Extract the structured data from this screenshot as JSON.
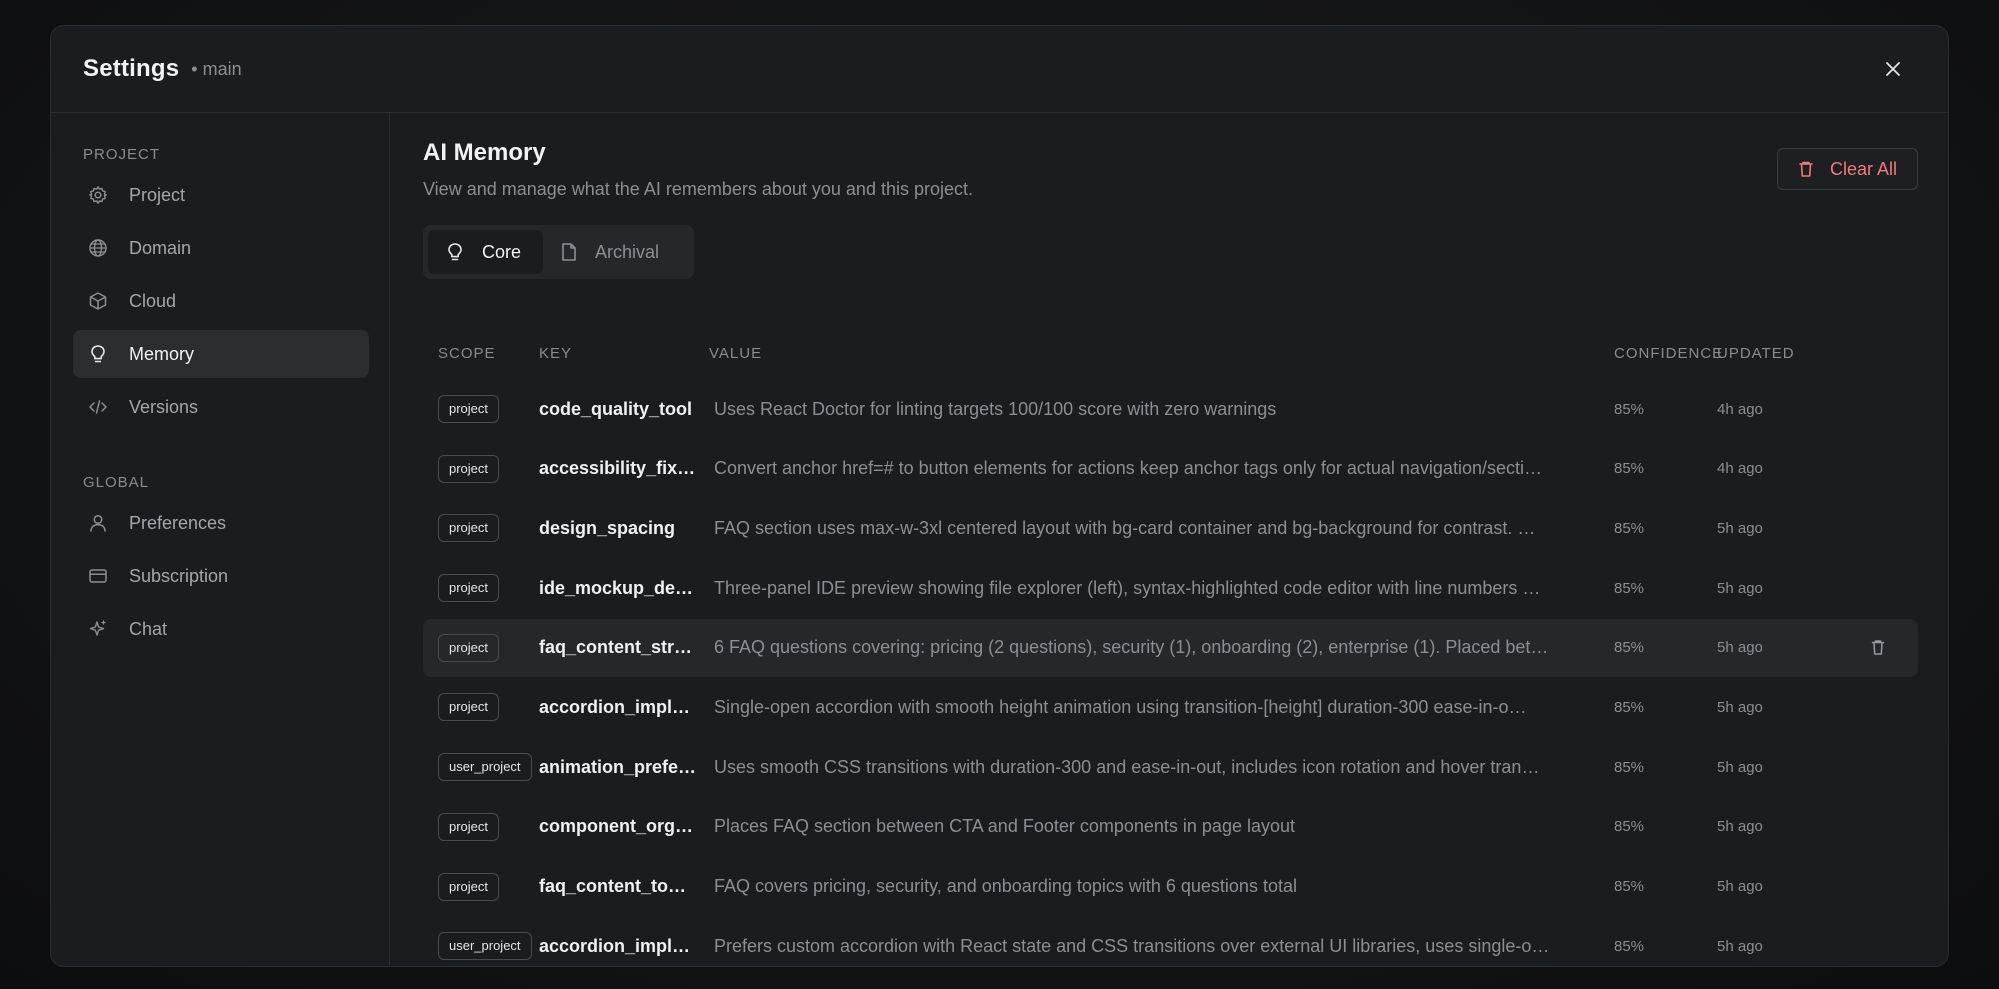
{
  "header": {
    "title": "Settings",
    "subtitle": "• main"
  },
  "sidebar": {
    "project_label": "PROJECT",
    "project_items": [
      {
        "label": "Project",
        "icon": "gear-icon"
      },
      {
        "label": "Domain",
        "icon": "globe-icon"
      },
      {
        "label": "Cloud",
        "icon": "cube-icon"
      },
      {
        "label": "Memory",
        "icon": "lightbulb-icon",
        "active": true
      },
      {
        "label": "Versions",
        "icon": "code-icon"
      }
    ],
    "global_label": "GLOBAL",
    "global_items": [
      {
        "label": "Preferences",
        "icon": "user-icon"
      },
      {
        "label": "Subscription",
        "icon": "credit-card-icon"
      },
      {
        "label": "Chat",
        "icon": "sparkle-icon"
      }
    ]
  },
  "main": {
    "title": "AI Memory",
    "description": "View and manage what the AI remembers about you and this project.",
    "clear_all": "Clear All",
    "tabs": [
      {
        "label": "Core",
        "icon": "lightbulb-icon",
        "active": true
      },
      {
        "label": "Archival",
        "icon": "file-icon"
      }
    ]
  },
  "table": {
    "headers": {
      "scope": "SCOPE",
      "key": "KEY",
      "value": "VALUE",
      "confidence": "CONFIDENCE",
      "updated": "UPDATED"
    },
    "rows": [
      {
        "scope": "project",
        "key": "code_quality_tool",
        "value": "Uses React Doctor for linting targets 100/100 score with zero warnings",
        "confidence": "85%",
        "updated": "4h ago"
      },
      {
        "scope": "project",
        "key": "accessibility_fix…",
        "value": "Convert anchor href=# to button elements for actions keep anchor tags only for actual navigation/secti…",
        "confidence": "85%",
        "updated": "4h ago"
      },
      {
        "scope": "project",
        "key": "design_spacing",
        "value": "FAQ section uses max-w-3xl centered layout with bg-card container and bg-background for contrast. …",
        "confidence": "85%",
        "updated": "5h ago"
      },
      {
        "scope": "project",
        "key": "ide_mockup_de…",
        "value": "Three-panel IDE preview showing file explorer (left), syntax-highlighted code editor with line numbers …",
        "confidence": "85%",
        "updated": "5h ago"
      },
      {
        "scope": "project",
        "key": "faq_content_str…",
        "value": "6 FAQ questions covering: pricing (2 questions), security (1), onboarding (2), enterprise (1). Placed bet…",
        "confidence": "85%",
        "updated": "5h ago",
        "hover": true
      },
      {
        "scope": "project",
        "key": "accordion_impl…",
        "value": "Single-open accordion with smooth height animation using transition-[height] duration-300 ease-in-o…",
        "confidence": "85%",
        "updated": "5h ago"
      },
      {
        "scope": "user_project",
        "key": "animation_prefe…",
        "value": "Uses smooth CSS transitions with duration-300 and ease-in-out, includes icon rotation and hover tran…",
        "confidence": "85%",
        "updated": "5h ago"
      },
      {
        "scope": "project",
        "key": "component_org…",
        "value": "Places FAQ section between CTA and Footer components in page layout",
        "confidence": "85%",
        "updated": "5h ago"
      },
      {
        "scope": "project",
        "key": "faq_content_to…",
        "value": "FAQ covers pricing, security, and onboarding topics with 6 questions total",
        "confidence": "85%",
        "updated": "5h ago"
      },
      {
        "scope": "user_project",
        "key": "accordion_impl…",
        "value": "Prefers custom accordion with React state and CSS transitions over external UI libraries, uses single-o…",
        "confidence": "85%",
        "updated": "5h ago"
      }
    ]
  },
  "colors": {
    "accent_danger": "#ef7b7b",
    "background": "#1b1c1f",
    "active_bg": "#2c2d31"
  }
}
